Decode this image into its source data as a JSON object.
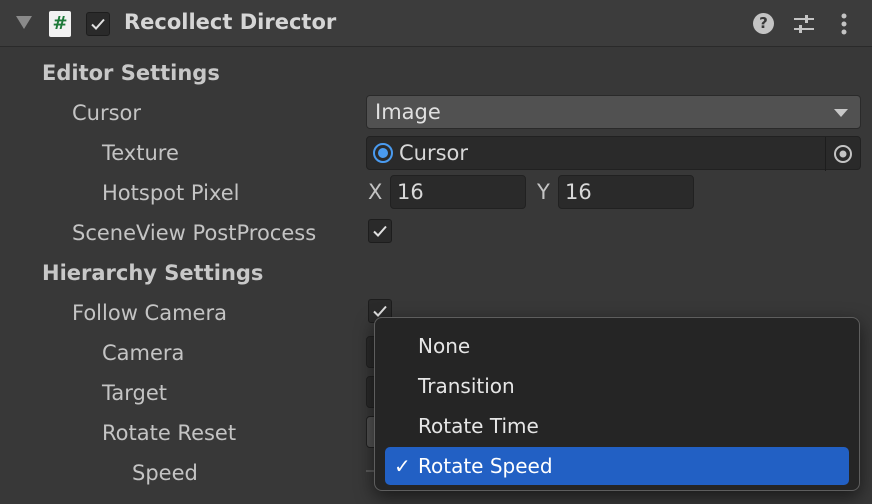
{
  "header": {
    "component_title": "Recollect Director",
    "script_icon_glyph": "#",
    "enabled": true
  },
  "editor_settings": {
    "section_label": "Editor Settings",
    "cursor_label": "Cursor",
    "cursor_value": "Image",
    "texture_label": "Texture",
    "texture_value": "Cursor",
    "hotspot_label": "Hotspot Pixel",
    "hotspot_x_label": "X",
    "hotspot_x": "16",
    "hotspot_y_label": "Y",
    "hotspot_y": "16",
    "sceneview_label": "SceneView PostProcess",
    "sceneview_checked": true
  },
  "hierarchy_settings": {
    "section_label": "Hierarchy Settings",
    "follow_camera_label": "Follow Camera",
    "follow_camera_checked": true,
    "camera_label": "Camera",
    "target_label": "Target",
    "rotate_reset_label": "Rotate Reset",
    "speed_label": "Speed"
  },
  "popup_menu": {
    "items": [
      {
        "label": "None",
        "selected": false
      },
      {
        "label": "Transition",
        "selected": false
      },
      {
        "label": "Rotate Time",
        "selected": false
      },
      {
        "label": "Rotate Speed",
        "selected": true
      }
    ],
    "check_glyph": "✓"
  },
  "icons": {
    "fold": "triangle-down-icon",
    "help": "help-icon",
    "presets": "sliders-icon",
    "menu": "kebab-icon",
    "object_picker": "target-icon"
  },
  "colors": {
    "background": "#383838",
    "selection": "#2260c4",
    "object_accent": "#4a9bf0"
  }
}
